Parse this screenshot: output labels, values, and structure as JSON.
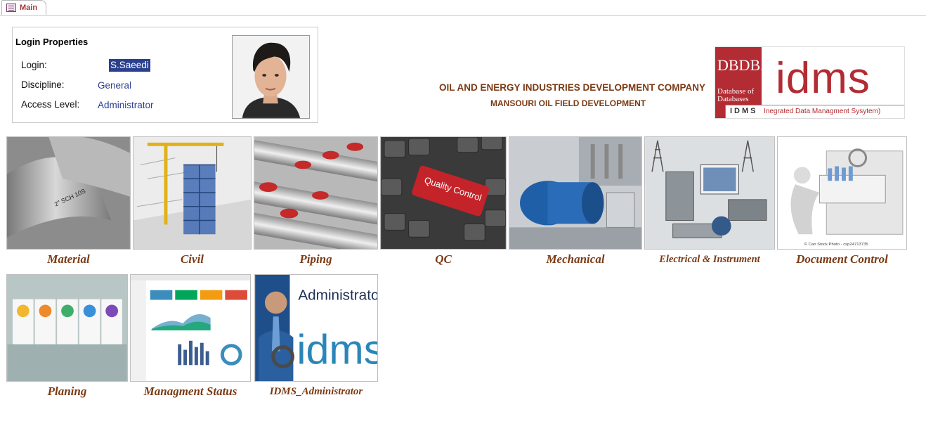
{
  "tab": {
    "label": "Main",
    "icon": "form-icon"
  },
  "login": {
    "title": "Login Properties",
    "login_label": "Login:",
    "login_value": "S.Saeedi",
    "discipline_label": "Discipline:",
    "discipline_value": "General",
    "access_label": "Access Level:",
    "access_value": "Administrator"
  },
  "company": {
    "name": "OIL AND ENERGY INDUSTRIES DEVELOPMENT COMPANY",
    "project": "MANSOURI OIL FIELD DEVELOPMENT"
  },
  "logo": {
    "dbdb": "DBDB.io",
    "db_caption": "Database of Databases",
    "word": "idms",
    "abbr": "IDMS",
    "full": "Inegrated Data Managment Sysytem)"
  },
  "modules": [
    {
      "label": "Material",
      "icon": "pipe-fittings-image"
    },
    {
      "label": "Civil",
      "icon": "construction-crane-image"
    },
    {
      "label": "Piping",
      "icon": "valves-image"
    },
    {
      "label": "QC",
      "icon": "quality-control-keyboard-image"
    },
    {
      "label": "Mechanical",
      "icon": "pump-motor-image"
    },
    {
      "label": "Electrical & Instrument",
      "icon": "electrical-panels-image"
    },
    {
      "label": "Document Control",
      "icon": "document-drawer-image"
    },
    {
      "label": "Planing",
      "icon": "planning-cards-image"
    },
    {
      "label": "Managment Status",
      "icon": "dashboard-image"
    },
    {
      "label": "IDMS_Administrator",
      "icon": "administrator-image"
    }
  ],
  "captions": {
    "qc_key": "Quality Control",
    "admin_title": "Administrator",
    "admin_word": "idms",
    "doc_watermark": "© Can Stock Photo - csp24713735",
    "material_stamp": "2\" SCH 10S"
  },
  "colors": {
    "label_brown": "#7b3a14",
    "value_blue": "#2b3f8f",
    "brand_red": "#b32b33"
  }
}
